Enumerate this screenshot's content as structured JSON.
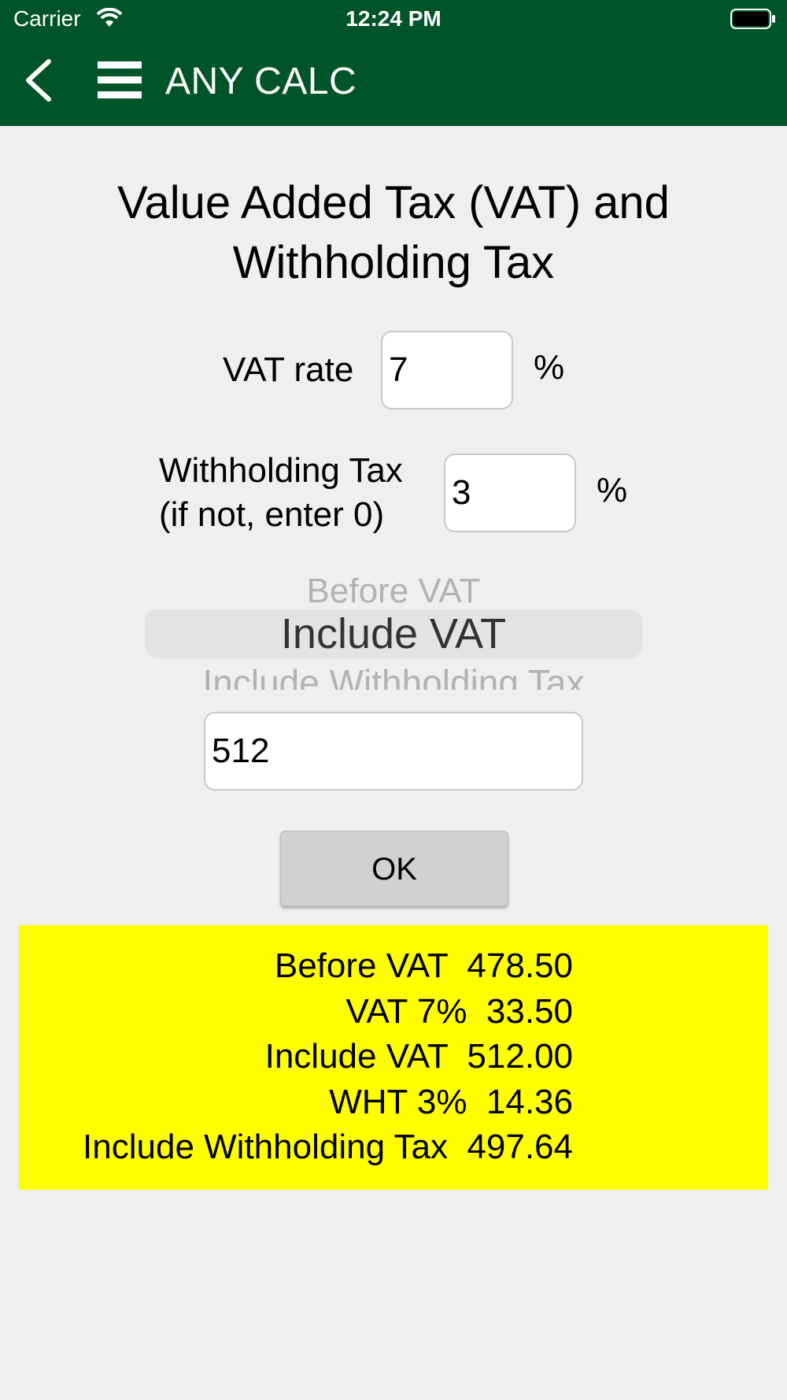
{
  "status_bar": {
    "carrier": "Carrier",
    "time": "12:24 PM"
  },
  "nav": {
    "title": "ANY CALC",
    "back_icon": "chevron-left-icon",
    "menu_icon": "hamburger-menu-icon",
    "bar_color": "#005429"
  },
  "page": {
    "title_line1": "Value Added Tax (VAT) and",
    "title_line2": "Withholding Tax"
  },
  "form": {
    "vat_label": "VAT rate",
    "vat_value": "7",
    "vat_unit": "%",
    "wht_label_line1": "Withholding Tax",
    "wht_label_line2": "(if not, enter 0)",
    "wht_value": "3",
    "wht_unit": "%",
    "amount_value": "512",
    "ok_label": "OK"
  },
  "picker": {
    "options": [
      "Before VAT",
      "Include VAT",
      "Include Withholding Tax"
    ],
    "above": "Before VAT",
    "selected": "Include VAT",
    "below": "Include Withholding Tax"
  },
  "results": {
    "background": "#ffff00",
    "lines": [
      "Before VAT  478.50",
      "VAT 7%  33.50",
      "Include VAT  512.00",
      "WHT 3%  14.36",
      "Include Withholding Tax  497.64"
    ]
  }
}
